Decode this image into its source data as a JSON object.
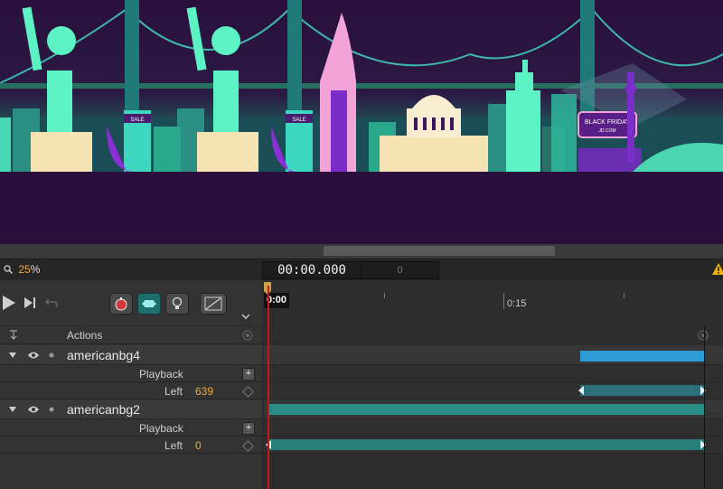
{
  "stage": {
    "skyline": {
      "sale_sign": "SALE",
      "black_friday_sign": "BLACK FRIDAY",
      "sign_subtext": "JD.COM"
    }
  },
  "statusbar": {
    "zoom_value": "25",
    "zoom_unit": "%",
    "time": "00:00.000",
    "frame": "0"
  },
  "ruler": {
    "playhead_time": "0:00",
    "mark_15": "0:15"
  },
  "timeline": {
    "actions_label": "Actions",
    "layers": [
      {
        "name": "americanbg4",
        "playback_label": "Playback",
        "prop_label": "Left",
        "prop_value": "639"
      },
      {
        "name": "americanbg2",
        "playback_label": "Playback",
        "prop_label": "Left",
        "prop_value": "0"
      }
    ]
  },
  "colors": {
    "accent_orange": "#f0a83c",
    "playhead_red": "#c21818",
    "action_blue": "#2c9bd6",
    "track_teal": "#2a8e86"
  }
}
